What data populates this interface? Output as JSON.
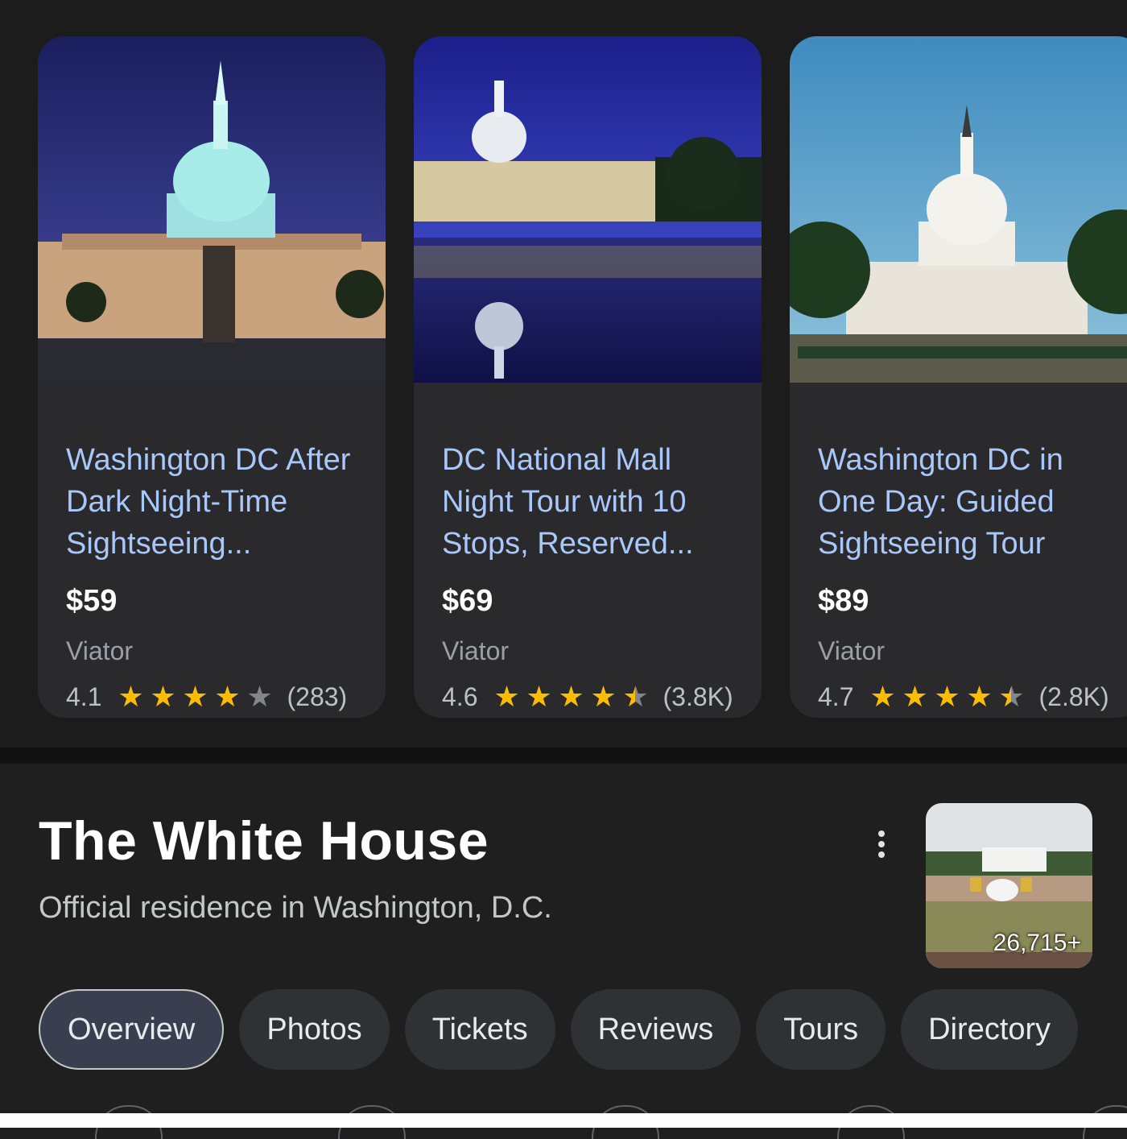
{
  "tours": [
    {
      "title": "Washington DC After Dark Night-Time Sightseeing...",
      "price": "$59",
      "source": "Viator",
      "rating": "4.1",
      "stars": 4.1,
      "reviews": "(283)",
      "image": "capitol-night-photo"
    },
    {
      "title": "DC National Mall Night Tour with 10 Stops, Reserved...",
      "price": "$69",
      "source": "Viator",
      "rating": "4.6",
      "stars": 4.6,
      "reviews": "(3.8K)",
      "image": "capitol-reflecting-pool-photo"
    },
    {
      "title": "Washington DC in One Day: Guided Sightseeing Tour",
      "price": "$89",
      "source": "Viator",
      "rating": "4.7",
      "stars": 4.7,
      "reviews": "(2.8K)",
      "image": "capitol-day-photo"
    }
  ],
  "place": {
    "title": "The White House",
    "subtitle": "Official residence in Washington, D.C.",
    "photo_count": "26,715+",
    "more_icon": "more-vert-icon"
  },
  "tabs": [
    {
      "label": "Overview",
      "active": true
    },
    {
      "label": "Photos",
      "active": false
    },
    {
      "label": "Tickets",
      "active": false
    },
    {
      "label": "Reviews",
      "active": false
    },
    {
      "label": "Tours",
      "active": false
    },
    {
      "label": "Directory",
      "active": false
    }
  ],
  "colors": {
    "background": "#1f1f1f",
    "card": "#2a2a2c",
    "link": "#a8c7fa",
    "star": "#fbbc04",
    "chip": "#303134",
    "chip_active": "#3a3f4f"
  }
}
